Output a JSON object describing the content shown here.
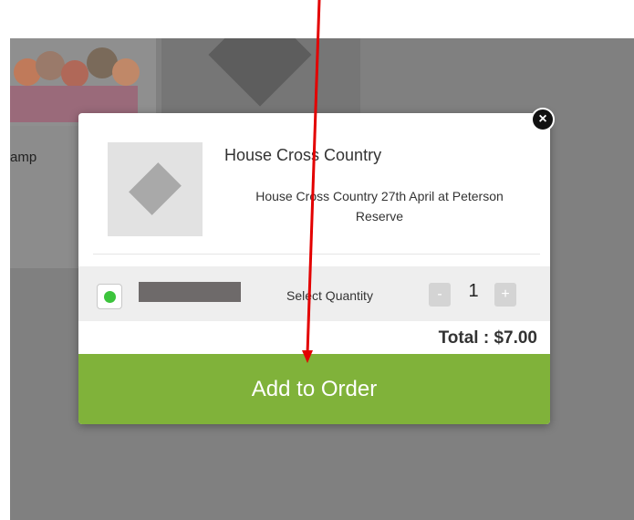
{
  "background": {
    "card1_label": "amp"
  },
  "modal": {
    "close_label": "×",
    "title": "House Cross Country",
    "description": "House Cross Country 27th April at Peterson Reserve",
    "option": {
      "selected": true,
      "quantity_label": "Select Quantity",
      "minus_label": "-",
      "plus_label": "+",
      "quantity": "1"
    },
    "total": "Total : $7.00",
    "add_button_label": "Add to Order"
  },
  "colors": {
    "accent_green": "#80b23a",
    "radio_green": "#3cc43c",
    "arrow_red": "#e30000"
  }
}
